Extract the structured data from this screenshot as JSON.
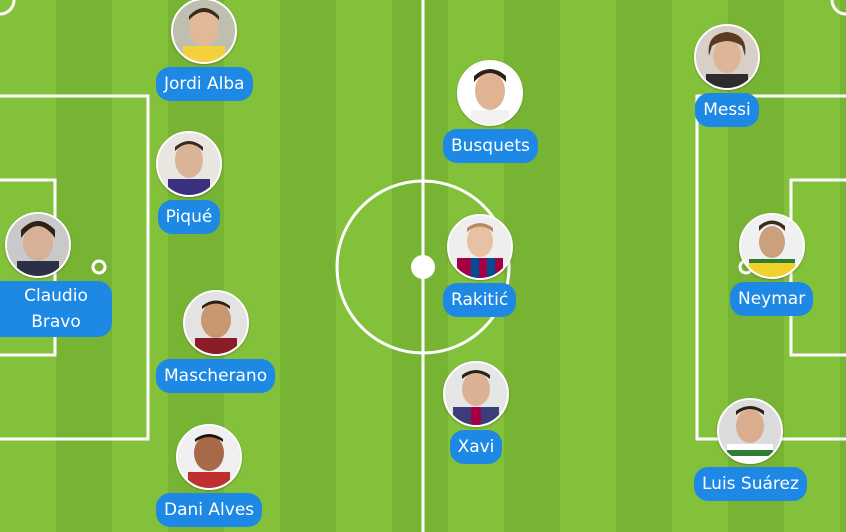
{
  "formation": {
    "players": [
      {
        "id": "jordi-alba",
        "name": "Jordi Alba",
        "jersey_color": "#f4d03f",
        "skin": "#e2b896",
        "hair": "#3a2a1e"
      },
      {
        "id": "pique",
        "name": "Piqué",
        "jersey_color": "#3b2f80",
        "skin": "#dbb498",
        "hair": "#3a2a1e"
      },
      {
        "id": "claudio-bravo",
        "name": "Claudio Bravo",
        "jersey_color": "#2c2f45",
        "skin": "#d7b197",
        "hair": "#2e2218"
      },
      {
        "id": "mascherano",
        "name": "Mascherano",
        "jersey_color": "#8a1c2a",
        "skin": "#c99873",
        "hair": "#2b1f17"
      },
      {
        "id": "dani-alves",
        "name": "Dani Alves",
        "jersey_color": "#ffffff",
        "skin": "#a8684a",
        "hair": "#1b1410"
      },
      {
        "id": "busquets",
        "name": "Busquets",
        "jersey_color": "#ffffff",
        "skin": "#e0b493",
        "hair": "#2b1f17"
      },
      {
        "id": "rakitic",
        "name": "Rakitić",
        "jersey_color": "#a50044",
        "skin": "#e8c0a3",
        "hair": "#b88a5a"
      },
      {
        "id": "xavi",
        "name": "Xavi",
        "jersey_color": "#3a3f7a",
        "skin": "#dcb092",
        "hair": "#2b1f17"
      },
      {
        "id": "messi",
        "name": "Messi",
        "jersey_color": "#2d2b2b",
        "skin": "#dfb597",
        "hair": "#5a3a22"
      },
      {
        "id": "neymar",
        "name": "Neymar",
        "jersey_color": "#f1d22a",
        "skin": "#caa07d",
        "hair": "#3b2b1d"
      },
      {
        "id": "luis-suarez",
        "name": "Luis Suárez",
        "jersey_color": "#2e7d32",
        "skin": "#d9ad8e",
        "hair": "#2b1f17"
      }
    ]
  },
  "colors": {
    "grass_light": "#84c13a",
    "grass_dark": "#78b434",
    "line": "#ffffff",
    "name_tag": "#1e88e5"
  }
}
